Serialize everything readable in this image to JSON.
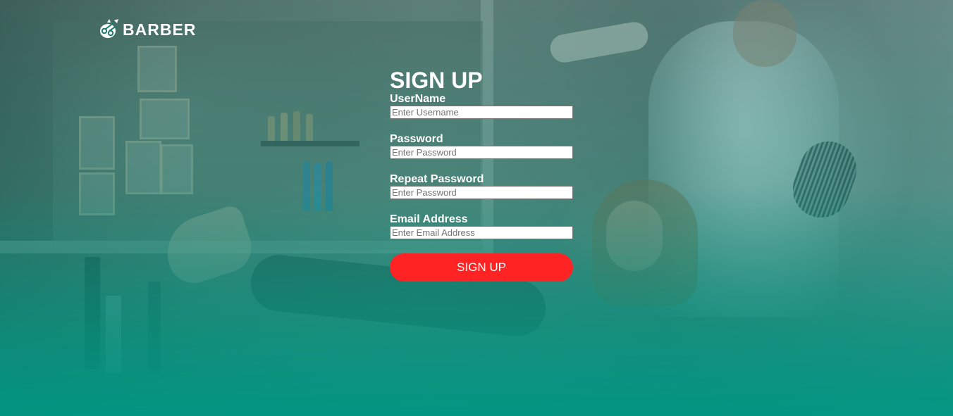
{
  "brand": {
    "name": "BARBER",
    "icon": "barber-scissors-logo-icon"
  },
  "signup": {
    "title": "SIGN UP",
    "fields": [
      {
        "label": "UserName",
        "placeholder": "Enter Username",
        "value": ""
      },
      {
        "label": "Password",
        "placeholder": "Enter Password",
        "value": ""
      },
      {
        "label": "Repeat Password",
        "placeholder": "Enter Password",
        "value": ""
      },
      {
        "label": "Email Address",
        "placeholder": "Enter Email Address",
        "value": ""
      }
    ],
    "submit_label": "SIGN UP"
  },
  "colors": {
    "overlay_teal": "#009682",
    "button_red": "#ff2323",
    "text": "#ffffff"
  }
}
